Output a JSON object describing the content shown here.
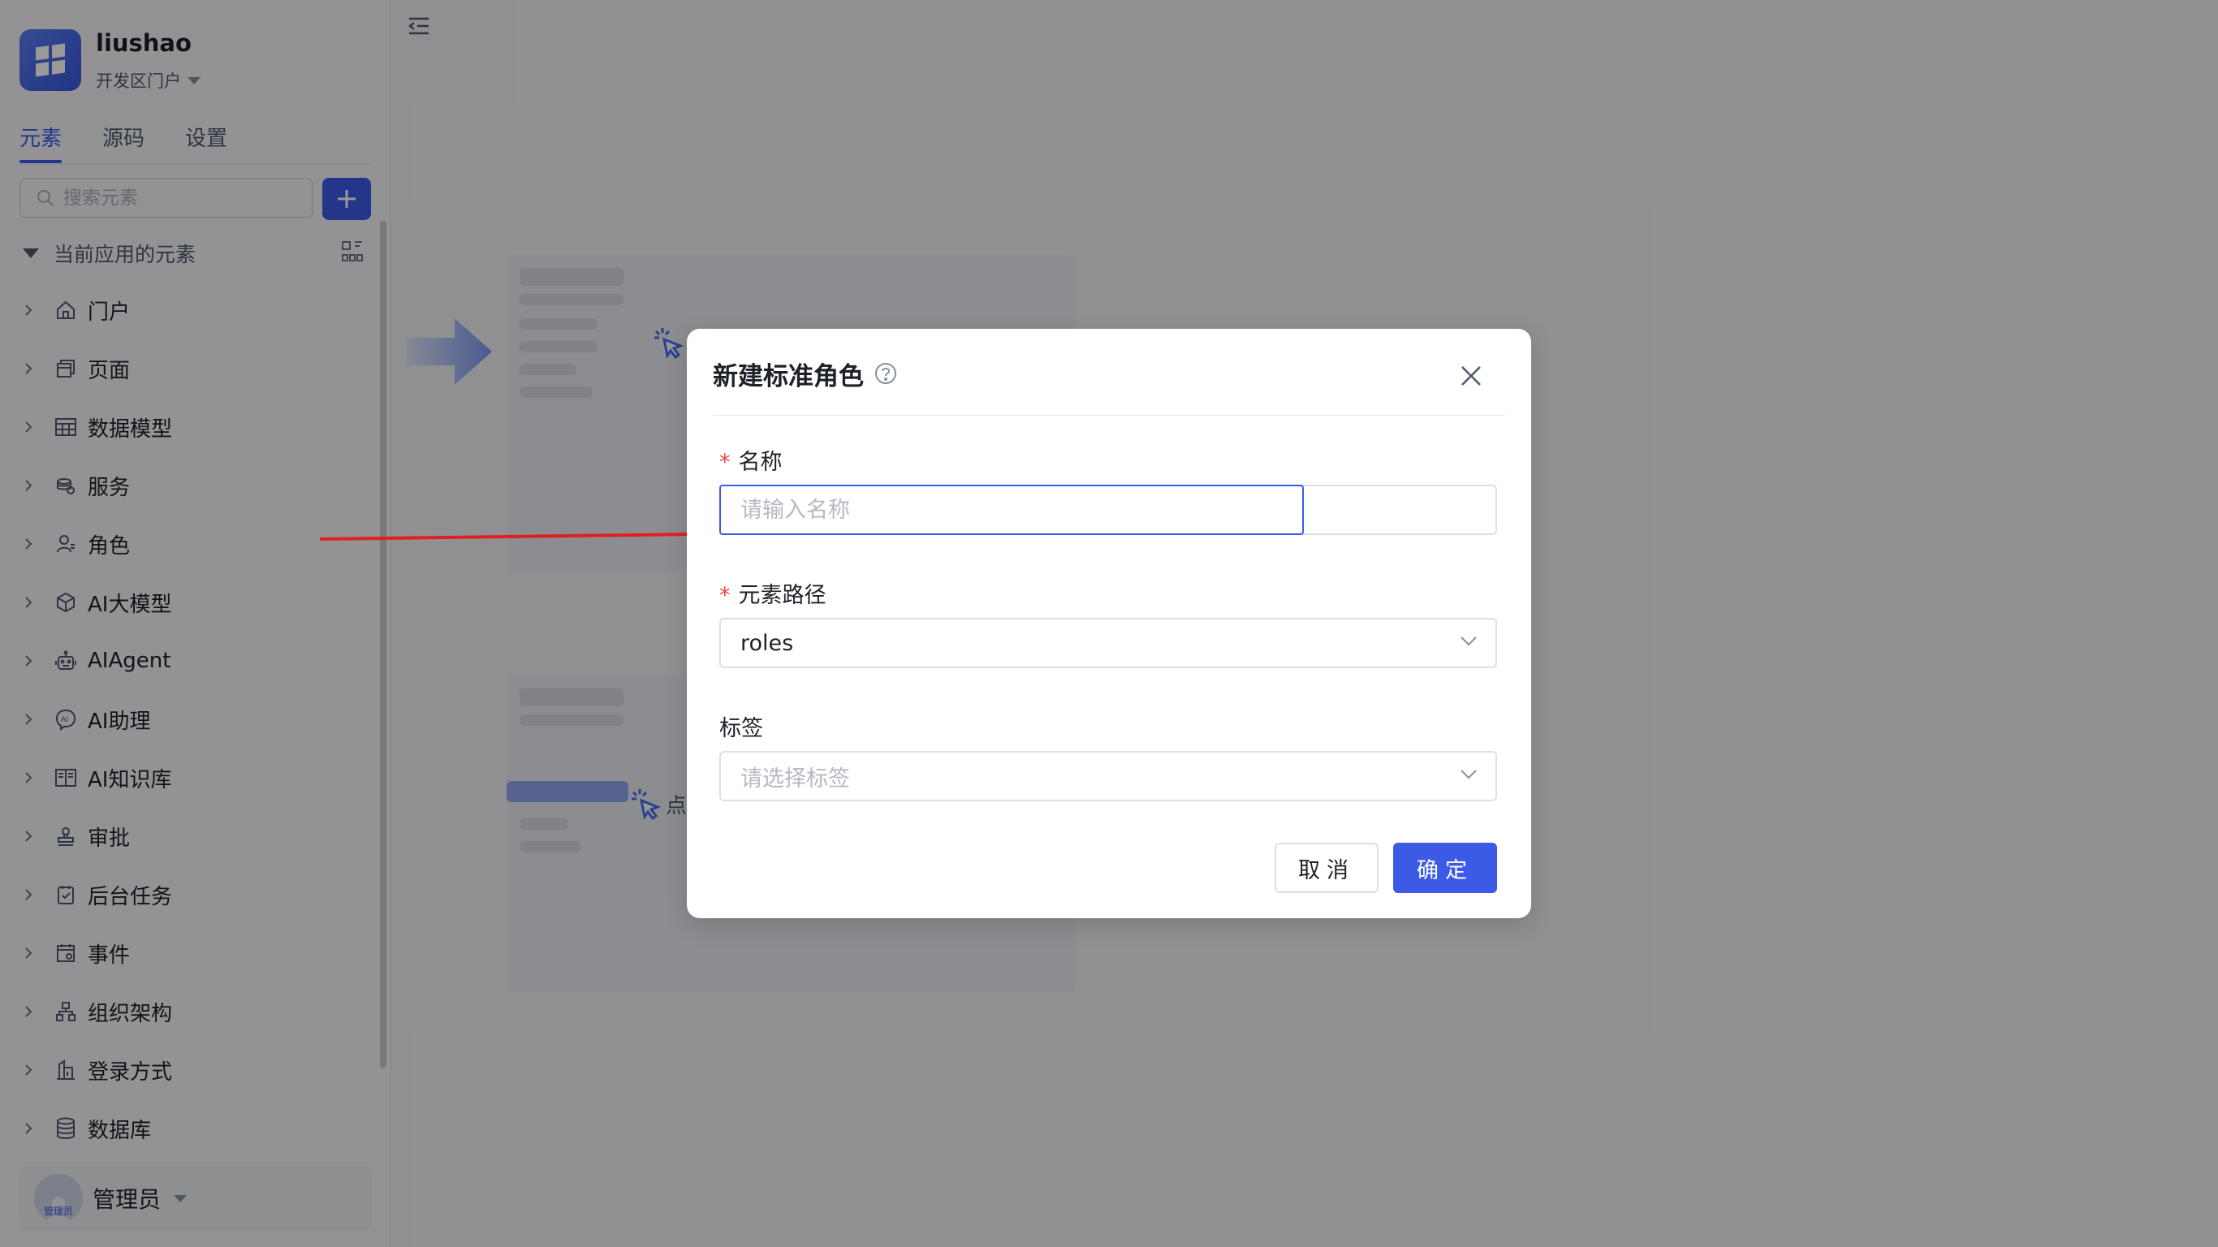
{
  "app": {
    "name": "liushao",
    "portal": "开发区门户"
  },
  "tabs": [
    {
      "label": "元素"
    },
    {
      "label": "源码"
    },
    {
      "label": "设置"
    }
  ],
  "search": {
    "placeholder": "搜索元素"
  },
  "section": {
    "title": "当前应用的元素"
  },
  "tree": [
    {
      "label": "门户",
      "icon": "home-icon"
    },
    {
      "label": "页面",
      "icon": "page-icon"
    },
    {
      "label": "数据模型",
      "icon": "table-icon"
    },
    {
      "label": "服务",
      "icon": "service-icon"
    },
    {
      "label": "角色",
      "icon": "role-icon"
    },
    {
      "label": "AI大模型",
      "icon": "model-icon"
    },
    {
      "label": "AIAgent",
      "icon": "robot-icon"
    },
    {
      "label": "AI助理",
      "icon": "assistant-icon"
    },
    {
      "label": "AI知识库",
      "icon": "book-icon"
    },
    {
      "label": "审批",
      "icon": "stamp-icon"
    },
    {
      "label": "后台任务",
      "icon": "task-icon"
    },
    {
      "label": "事件",
      "icon": "event-icon"
    },
    {
      "label": "组织架构",
      "icon": "org-icon"
    },
    {
      "label": "登录方式",
      "icon": "login-icon"
    },
    {
      "label": "数据库",
      "icon": "database-icon"
    }
  ],
  "user": {
    "name": "管理员",
    "avatar_text": "管理员"
  },
  "modal": {
    "title": "新建标准角色",
    "name_label": "名称",
    "name_placeholder": "请输入名称",
    "path_label": "元素路径",
    "path_value": "roles",
    "tag_label": "标签",
    "tag_placeholder": "请选择标签",
    "cancel_label": "取消",
    "ok_label": "确定"
  },
  "illustration": {
    "click_text": "点"
  },
  "colors": {
    "accent": "#3c5ae6",
    "required": "#f53f3f",
    "annotation_arrow": "#e02020"
  }
}
